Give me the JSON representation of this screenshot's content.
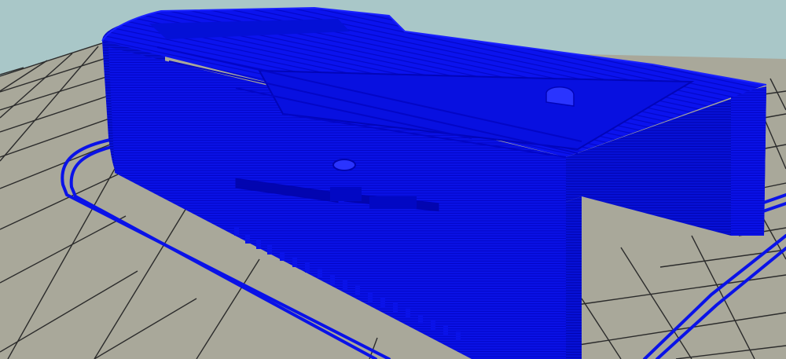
{
  "viewport": {
    "background_sky": "#a9c7c8",
    "bed_color": "#a9a89a",
    "bed_grid_line": "#2b2b2b",
    "toolpath_color": "#0a12e8",
    "toolpath_dark": "#0000b0",
    "toolpath_light": "#2a34ff"
  }
}
